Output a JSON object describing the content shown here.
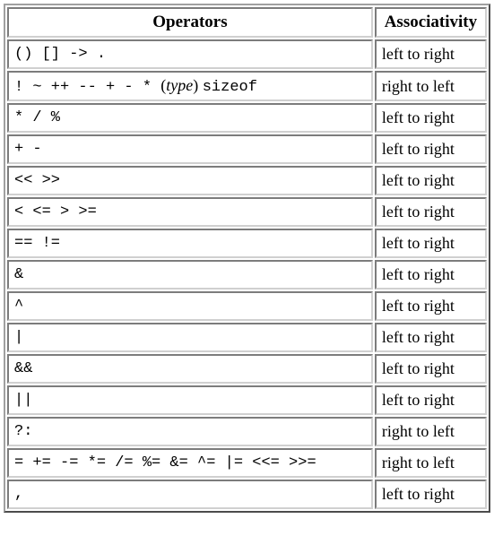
{
  "headers": {
    "operators": "Operators",
    "associativity": "Associativity"
  },
  "assoc_labels": {
    "ltr": "left to right",
    "rtl": "right to left"
  },
  "rows": [
    {
      "assoc_key": "ltr",
      "ops": "()  []  ->  ."
    },
    {
      "assoc_key": "rtl",
      "special_row2": true,
      "p1": "!  ~  ++  --  +  -  * ",
      "paren_open": "(",
      "type_word": "type",
      "paren_close": ") ",
      "sizeof": "sizeof"
    },
    {
      "assoc_key": "ltr",
      "ops": "*  /  %"
    },
    {
      "assoc_key": "ltr",
      "ops": "+  -"
    },
    {
      "assoc_key": "ltr",
      "ops": "<<   >>"
    },
    {
      "assoc_key": "ltr",
      "ops": "<  <=  >  >="
    },
    {
      "assoc_key": "ltr",
      "ops": "==  !="
    },
    {
      "assoc_key": "ltr",
      "ops": "&"
    },
    {
      "assoc_key": "ltr",
      "ops": "^"
    },
    {
      "assoc_key": "ltr",
      "ops": "|"
    },
    {
      "assoc_key": "ltr",
      "ops": "&&"
    },
    {
      "assoc_key": "ltr",
      "ops": "||"
    },
    {
      "assoc_key": "rtl",
      "ops": "?:"
    },
    {
      "assoc_key": "rtl",
      "ops": "=  +=  -=  *=  /=  %=  &=  ^=  |=  <<=  >>="
    },
    {
      "assoc_key": "ltr",
      "ops": ","
    }
  ]
}
